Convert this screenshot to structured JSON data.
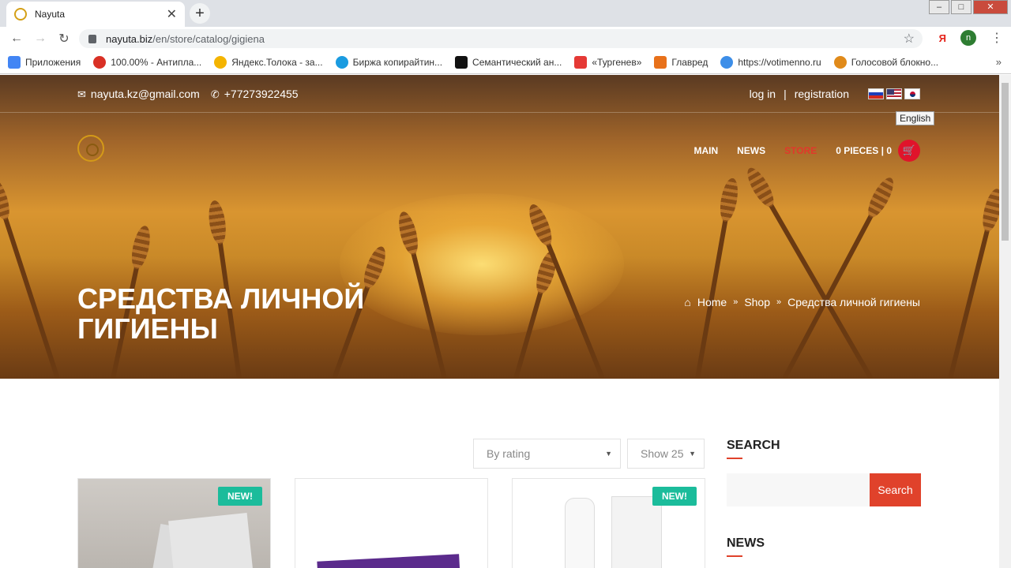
{
  "browser": {
    "tab_title": "Nayuta",
    "url_host": "nayuta.biz",
    "url_path": "/en/store/catalog/gigiena",
    "profile_initial": "n",
    "ya_label": "Я",
    "bookmarks": [
      {
        "label": "Приложения",
        "color": "#4285f4"
      },
      {
        "label": "100.00% - Антипла...",
        "color": "#d93025"
      },
      {
        "label": "Яндекс.Толока - за...",
        "color": "#f4b400"
      },
      {
        "label": "Биржа копирайтин...",
        "color": "#1a9be0"
      },
      {
        "label": "Семантический ан...",
        "color": "#111111"
      },
      {
        "label": "«Тургенев»",
        "color": "#e53935"
      },
      {
        "label": "Главред",
        "color": "#e8711a"
      },
      {
        "label": "https://votimenno.ru",
        "color": "#3d8ee8"
      },
      {
        "label": "Голосовой блокно...",
        "color": "#e08a1a"
      }
    ]
  },
  "site": {
    "email": "nayuta.kz@gmail.com",
    "phone": "+77273922455",
    "login": "log in",
    "divider": "|",
    "registration": "registration",
    "flag_tooltip": "English",
    "menu": {
      "main": "MAIN",
      "news": "NEWS",
      "store": "STORE",
      "cart": "0 PIECES | 0"
    },
    "page_title": "СРЕДСТВА ЛИЧНОЙ ГИГИЕНЫ",
    "breadcrumb": {
      "home": "Home",
      "shop": "Shop",
      "current": "Средства личной гигиены"
    },
    "sort_select": "By rating",
    "show_select": "Show 25",
    "badge_new": "NEW!",
    "sidebar": {
      "search_title": "SEARCH",
      "search_button": "Search",
      "news_title": "NEWS"
    }
  }
}
